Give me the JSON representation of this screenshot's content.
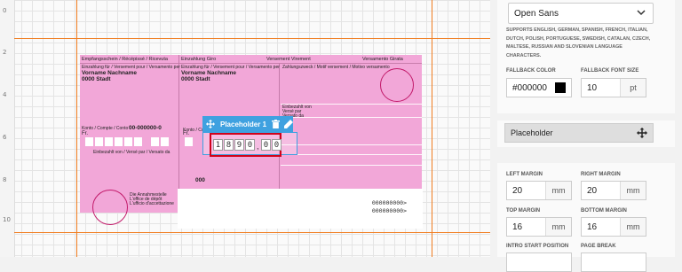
{
  "ruler": {
    "marks": [
      "0",
      "2",
      "4",
      "6",
      "8",
      "10"
    ]
  },
  "slip": {
    "header": {
      "left": "Empfangsschein / Récépissé / Ricevuta",
      "mid": "Einzahlung Giro",
      "mid2": "Versement Virement",
      "right": "Versamento Girata"
    },
    "small_text": {
      "left_account_for": "Einzahlung für / Versement pour / Versamento per",
      "mid_account_for": "Einzahlung für / Versement pour / Versamento per",
      "reason": "Zahlungszweck / Motif versement / Motivo versamento",
      "account_label": "Konto / Compte / Conto",
      "account_label2": "Konto / Compte / Conto",
      "paid_by": "Einbezahlt von / Versé par / Versato da",
      "paid_by_right": "Einbezahlt von\nVersé par\nVersato da",
      "receiver": "Die Annahmestelle\nL'office de dépôt\nL'ufficio d'accettazione",
      "chf": "Fr.",
      "chf2": "Fr."
    },
    "left_name": "Vorname Nachname",
    "left_city": "0000 Stadt",
    "mid_name": "Vorname Nachname",
    "mid_city": "0000 Stadt",
    "account_number": "00-000000-0",
    "code": "000",
    "ref_1": "000000000>",
    "ref_2": "000000000>"
  },
  "placeholder": {
    "label": "Placeholder 1",
    "digits": [
      "1",
      "8",
      "9",
      "0",
      "0",
      "0"
    ],
    "separator": ","
  },
  "panel": {
    "font": {
      "value": "Open Sans"
    },
    "font_note": "SUPPORTS ENGLISH, GERMAN, SPANISH, FRENCH, ITALIAN, DUTCH, POLISH, PORTUGUESE, SWEDISH, CATALAN, CZECH, MALTESE, RUSSIAN AND SLOVENIAN LANGUAGE CHARACTERS.",
    "fallback_color": {
      "label": "FALLBACK COLOR",
      "value": "#000000",
      "swatch": "#000000"
    },
    "fallback_size": {
      "label": "FALLBACK FONT SIZE",
      "value": "10",
      "unit": "pt"
    },
    "placeholder_title": "Placeholder",
    "left_margin": {
      "label": "LEFT MARGIN",
      "value": "20",
      "unit": "mm"
    },
    "right_margin": {
      "label": "RIGHT MARGIN",
      "value": "20",
      "unit": "mm"
    },
    "top_margin": {
      "label": "TOP MARGIN",
      "value": "16",
      "unit": "mm"
    },
    "bottom_margin": {
      "label": "BOTTOM MARGIN",
      "value": "16",
      "unit": "mm"
    },
    "intro_start": {
      "label": "INTRO START POSITION"
    },
    "page_break": {
      "label": "PAGE BREAK"
    }
  },
  "colors": {
    "guide": "#f07d20",
    "slip": "#f2a7d8",
    "accent": "#3fa1e0",
    "highlight": "#d0021b"
  }
}
